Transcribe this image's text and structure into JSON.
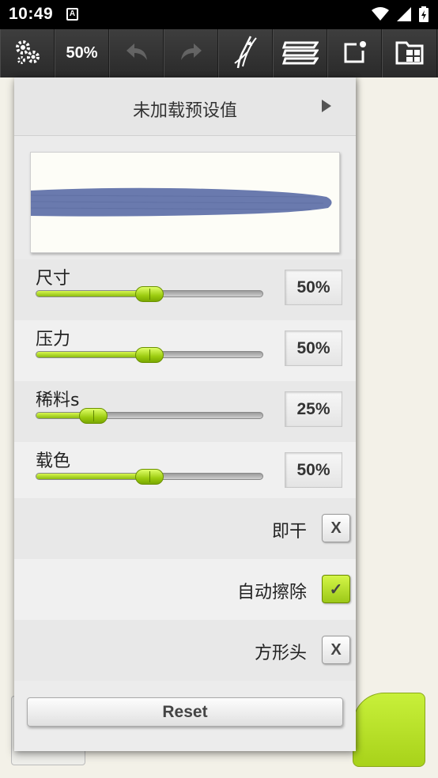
{
  "status_bar": {
    "time": "10:49",
    "app_icon_letter": "A",
    "icons": [
      "wifi-icon",
      "signal-icon",
      "battery-icon"
    ]
  },
  "toolbar": {
    "settings_icon": "gears-icon",
    "zoom_label": "50%",
    "undo_icon": "undo-icon",
    "redo_icon": "redo-icon",
    "brush_icon": "brush-icon",
    "layers_icon": "layers-icon",
    "export_icon": "export-icon",
    "gallery_icon": "gallery-icon"
  },
  "brush_panel": {
    "preset_label": "未加载预设值",
    "stroke_color": "#6a7aae",
    "sliders": [
      {
        "label": "尺寸",
        "value_text": "50%",
        "value": 0.5
      },
      {
        "label": "压力",
        "value_text": "50%",
        "value": 0.5
      },
      {
        "label": "稀料s",
        "value_text": "25%",
        "value": 0.25
      },
      {
        "label": "载色",
        "value_text": "50%",
        "value": 0.5
      }
    ],
    "toggles": [
      {
        "label": "即干",
        "checked": false,
        "mark": "X"
      },
      {
        "label": "自动擦除",
        "checked": true,
        "mark": "✓"
      },
      {
        "label": "方形头",
        "checked": false,
        "mark": "X"
      }
    ],
    "reset_label": "Reset"
  },
  "accent_color": "#b4e028"
}
